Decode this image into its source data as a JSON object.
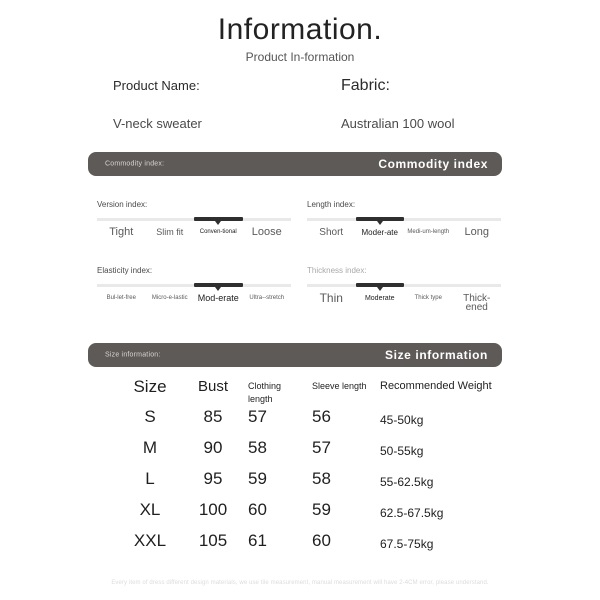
{
  "header": {
    "title": "Information.",
    "subtitle": "Product In-formation"
  },
  "product": {
    "name_label": "Product Name:",
    "name_value": "V-neck sweater",
    "fabric_label": "Fabric:",
    "fabric_value": "Australian 100 wool"
  },
  "banners": {
    "commodity": {
      "left": "Commodity index:",
      "right": "Commodity index"
    },
    "size": {
      "left": "Size information:",
      "right": "Size information"
    }
  },
  "indexes": [
    {
      "title": "Version index:",
      "options": [
        "Tight",
        "Slim fit",
        "Conven-tional",
        "Loose"
      ],
      "selected": 2
    },
    {
      "title": "Length index:",
      "options": [
        "Short",
        "Moder-ate",
        "Medi-um-length",
        "Long"
      ],
      "selected": 1
    },
    {
      "title": "Elasticity index:",
      "options": [
        "Bul-let-free",
        "Micro-e-lastic",
        "Mod-erate",
        "Ultra--stretch"
      ],
      "selected": 2
    },
    {
      "title": "Thickness index:",
      "options": [
        "Thin",
        "Moderate",
        "Thick type",
        "Thick-ened"
      ],
      "selected": 1
    }
  ],
  "size_table": {
    "headers": [
      "Size",
      "Bust",
      "Clothing length",
      "Sleeve length",
      "Recommended Weight"
    ],
    "rows": [
      {
        "size": "S",
        "bust": "85",
        "clothing": "57",
        "sleeve": "56",
        "weight": "45-50kg"
      },
      {
        "size": "M",
        "bust": "90",
        "clothing": "58",
        "sleeve": "57",
        "weight": "50-55kg"
      },
      {
        "size": "L",
        "bust": "95",
        "clothing": "59",
        "sleeve": "58",
        "weight": "55-62.5kg"
      },
      {
        "size": "XL",
        "bust": "100",
        "clothing": "60",
        "sleeve": "59",
        "weight": "62.5-67.5kg"
      },
      {
        "size": "XXL",
        "bust": "105",
        "clothing": "61",
        "sleeve": "60",
        "weight": "67.5-75kg"
      }
    ]
  },
  "footer": {
    "note": "Every item of dress different design materials, we use tile measurement, manual measurement will have 2-4CM error, please understand."
  },
  "colors": {
    "banner": "#5e5a57",
    "track_active": "#2f2f2f",
    "track_base": "#e9e9e9"
  }
}
